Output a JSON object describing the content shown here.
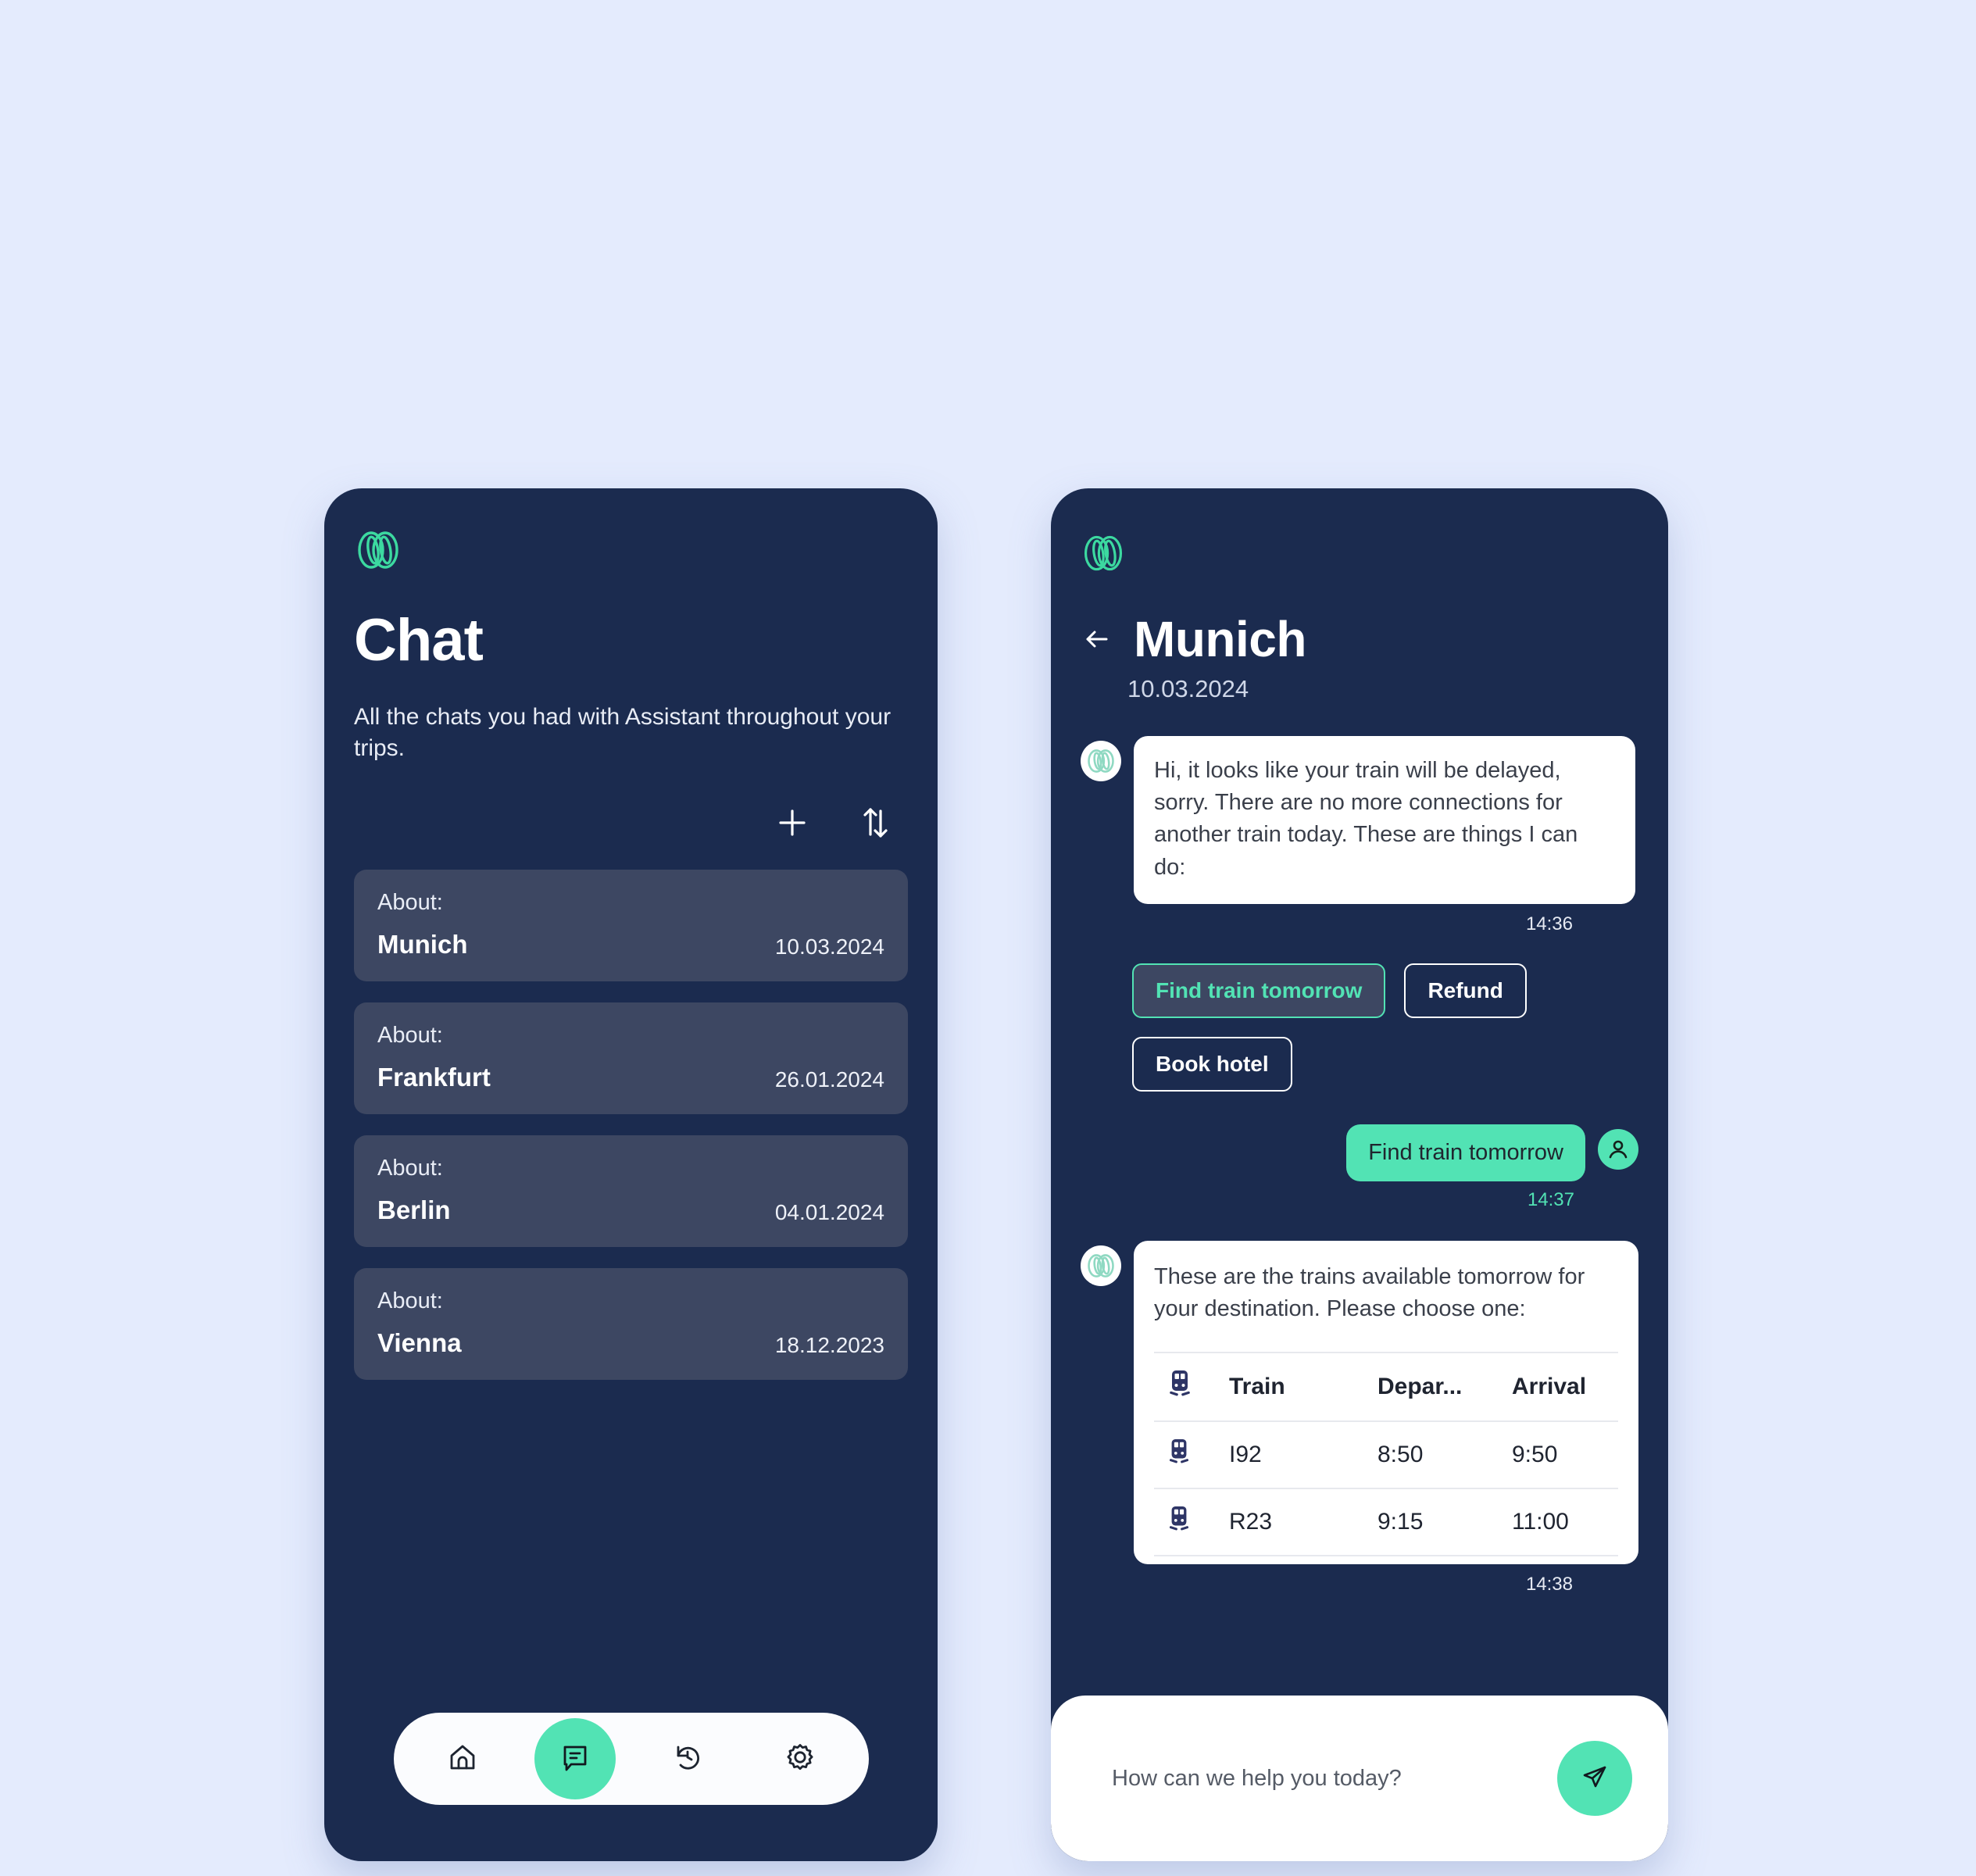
{
  "colors": {
    "background": "#e4ebfd",
    "panel_navy": "#1b2b4f",
    "card_slate": "#3d4762",
    "accent_green": "#52e3b4",
    "white": "#ffffff",
    "train_icon_navy": "#2e3566"
  },
  "left_screen": {
    "logo_name": "assistant-logo",
    "title": "Chat",
    "subtitle": "All the chats you had with Assistant throughout your trips.",
    "actions": [
      {
        "name": "add-chat-button",
        "icon": "plus-icon"
      },
      {
        "name": "sort-chats-button",
        "icon": "sort-arrows-icon"
      }
    ],
    "list_label": "About:",
    "chats": [
      {
        "about": "About:",
        "city": "Munich",
        "date": "10.03.2024"
      },
      {
        "about": "About:",
        "city": "Frankfurt",
        "date": "26.01.2024"
      },
      {
        "about": "About:",
        "city": "Berlin",
        "date": "04.01.2024"
      },
      {
        "about": "About:",
        "city": "Vienna",
        "date": "18.12.2023"
      }
    ],
    "bottom_nav": [
      {
        "name": "nav-home",
        "icon": "home-icon",
        "active": false
      },
      {
        "name": "nav-chat",
        "icon": "chat-icon",
        "active": true
      },
      {
        "name": "nav-history",
        "icon": "history-icon",
        "active": false
      },
      {
        "name": "nav-settings",
        "icon": "gear-icon",
        "active": false
      }
    ]
  },
  "right_screen": {
    "logo_name": "assistant-logo",
    "back_icon": "back-arrow-icon",
    "title": "Munich",
    "date": "10.03.2024",
    "messages": {
      "assistant_1": {
        "text": "Hi, it looks like your train will be delayed, sorry. There are no more connections for another train today. These are things I can do:",
        "time": "14:36"
      },
      "user_1": {
        "text": "Find train tomorrow",
        "time": "14:37"
      },
      "assistant_2": {
        "text": "These are the trains available tomorrow for your destination. Please choose one:",
        "time": "14:38"
      }
    },
    "quick_replies": [
      {
        "label": "Find train tomorrow",
        "selected": true
      },
      {
        "label": "Refund",
        "selected": false
      },
      {
        "label": "Book hotel",
        "selected": false
      }
    ],
    "train_table": {
      "headers": [
        "",
        "Train",
        "Depar...",
        "Arrival"
      ],
      "rows": [
        {
          "icon": "train-icon",
          "train": "I92",
          "departure": "8:50",
          "arrival": "9:50"
        },
        {
          "icon": "train-icon",
          "train": "R23",
          "departure": "9:15",
          "arrival": "11:00"
        }
      ]
    },
    "composer": {
      "placeholder": "How can we help you today?",
      "send_icon": "send-paper-plane-icon"
    }
  }
}
